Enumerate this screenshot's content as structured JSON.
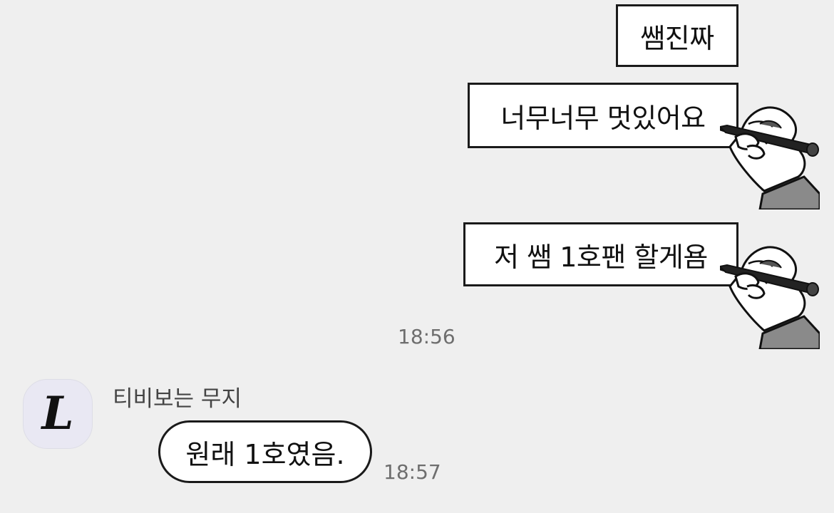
{
  "messages": {
    "m1": {
      "text": "쌤진짜"
    },
    "m2": {
      "text": "너무너무 멋있어요"
    },
    "m3": {
      "text": "저 쌤 1호팬 할게욤"
    },
    "time_sent": "18:56",
    "incoming": {
      "sender": "티비보는 무지",
      "avatar_letter": "L",
      "text": "원래 1호였음.",
      "time": "18:57"
    }
  },
  "icons": {
    "writing_hand": "writing-hand-sticker-icon",
    "avatar": "gothic-letter-avatar-icon"
  },
  "colors": {
    "background": "#efefef",
    "bubble": "#ffffff",
    "border": "#1a1a1a",
    "timestamp": "#6e6e6e"
  }
}
